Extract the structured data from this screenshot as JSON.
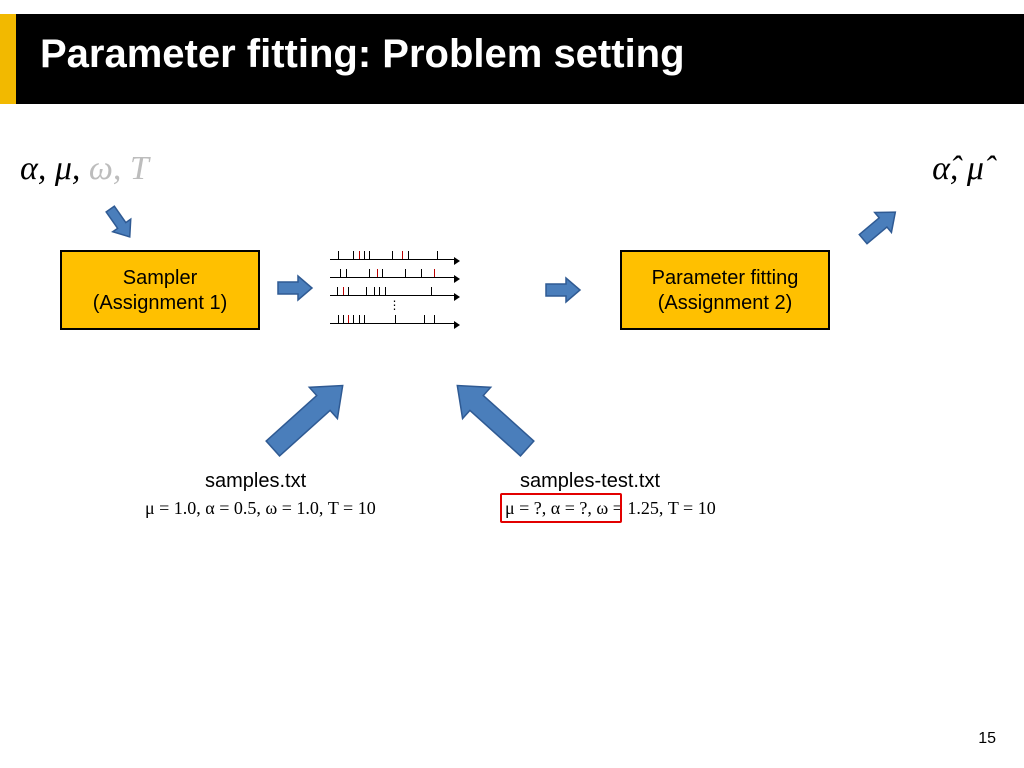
{
  "slide": {
    "title": "Parameter fitting: Problem setting",
    "page_number": "15"
  },
  "params": {
    "input_active": "α,  μ,",
    "input_dim": " ω, T",
    "output": "α̂, μ̂"
  },
  "boxes": {
    "sampler_line1": "Sampler",
    "sampler_line2": "(Assignment 1)",
    "fitting_line1": "Parameter fitting",
    "fitting_line2": "(Assignment 2)"
  },
  "files": {
    "file1_name": "samples.txt",
    "file1_params": "μ = 1.0,  α = 0.5,  ω = 1.0,  T = 10",
    "file2_name": "samples-test.txt",
    "file2_unknown": "μ = ?,  α = ?,",
    "file2_known": "  ω = 1.25,  T = 10"
  },
  "colors": {
    "accent": "#f2b900",
    "arrow": "#4a7ebb",
    "arrow_stroke": "#2f5a93"
  }
}
